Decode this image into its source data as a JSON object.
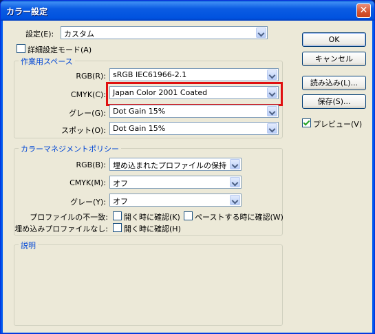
{
  "window": {
    "title": "カラー設定",
    "close_label": "✕"
  },
  "settings": {
    "label": "設定(E):",
    "value": "カスタム"
  },
  "advanced_mode": {
    "label": "詳細設定モード(A)",
    "checked": false
  },
  "working_spaces": {
    "legend": "作業用スペース",
    "rgb": {
      "label": "RGB(R):",
      "value": "sRGB IEC61966-2.1"
    },
    "cmyk": {
      "label": "CMYK(C):",
      "value": "Japan Color 2001 Coated"
    },
    "gray": {
      "label": "グレー(G):",
      "value": "Dot Gain 15%"
    },
    "spot": {
      "label": "スポット(O):",
      "value": "Dot Gain 15%"
    }
  },
  "color_management": {
    "legend": "カラーマネジメントポリシー",
    "rgb": {
      "label": "RGB(B):",
      "value": "埋め込まれたプロファイルの保持"
    },
    "cmyk": {
      "label": "CMYK(M):",
      "value": "オフ"
    },
    "gray": {
      "label": "グレー(Y):",
      "value": "オフ"
    },
    "mismatch": {
      "label": "プロファイルの不一致:",
      "open_label": "開く時に確認(K)",
      "paste_label": "ペーストする時に確認(W)"
    },
    "missing": {
      "label": "埋め込みプロファイルなし:",
      "open_label": "開く時に確認(H)"
    }
  },
  "description": {
    "legend": "説明",
    "text": ""
  },
  "buttons": {
    "ok": "OK",
    "cancel": "キャンセル",
    "load": "読み込み(L)...",
    "save": "保存(S)..."
  },
  "preview": {
    "label": "プレビュー(V)",
    "checked": true
  },
  "colors": {
    "highlight": "#e01010",
    "group_title": "#0046d5",
    "face": "#ece9d8"
  }
}
